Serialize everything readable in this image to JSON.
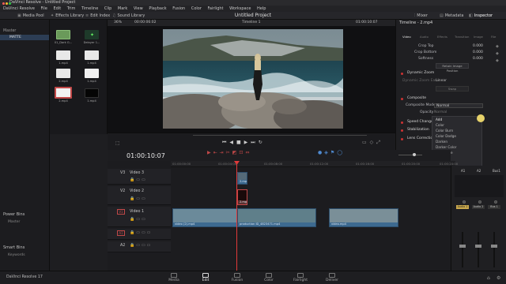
{
  "window": {
    "title": "DaVinci Resolve - Untitled Project"
  },
  "menu": [
    "DaVinci Resolve",
    "File",
    "Edit",
    "Trim",
    "Timeline",
    "Clip",
    "Mark",
    "View",
    "Playback",
    "Fusion",
    "Color",
    "Fairlight",
    "Workspace",
    "Help"
  ],
  "toolbar": {
    "media_pool": "Media Pool",
    "effects_library": "Effects Library",
    "edit_index": "Edit Index",
    "sound_library": "Sound Library",
    "project_title": "Untitled Project",
    "mixer": "Mixer",
    "metadata": "Metadata",
    "inspector": "Inspector"
  },
  "bins": {
    "master": "Master",
    "matte": "MATTE",
    "power_bins": "Power Bins",
    "power_master": "Master",
    "smart_bins": "Smart Bins",
    "keywords": "Keywords"
  },
  "media_pool": {
    "items": [
      {
        "name": "01_Dark G...",
        "color": "#6a9a5a"
      },
      {
        "name": "Delayer 1...",
        "color": "#2d5a3a"
      },
      {
        "name": "1.mp4",
        "color": "#e8e8e8"
      },
      {
        "name": "1.mp4",
        "color": "#e8e8e8"
      },
      {
        "name": "2.mp4",
        "color": "#e8e8e8"
      },
      {
        "name": "1.mp4",
        "color": "#f0f0f0"
      },
      {
        "name": "2.mp4",
        "color": "#c08080"
      },
      {
        "name": "1.mp4",
        "color": "#050505"
      }
    ]
  },
  "viewer": {
    "zoom": "36%",
    "src_tc": "00:00:06:02",
    "timeline_name": "Timeline 1",
    "rec_tc": "01:00:10:07"
  },
  "inspector": {
    "clip_name": "Timeline - 2.mp4",
    "tabs": [
      "Video",
      "Audio",
      "Effects",
      "Transition",
      "Image",
      "File"
    ],
    "crop_top_label": "Crop Top",
    "crop_top_value": "0.000",
    "crop_bottom_label": "Crop Bottom",
    "crop_bottom_value": "0.000",
    "softness_label": "Softness",
    "softness_value": "0.000",
    "retain_label": "Retain Image Position",
    "dynamic_zoom_label": "Dynamic Zoom",
    "dz_ease_label": "Dynamic Zoom Ease",
    "dz_ease_value": "Linear",
    "swap_label": "Swap",
    "composite_label": "Composite",
    "composite_mode_label": "Composite Mode",
    "composite_mode_value": "Normal",
    "opacity_label": "Opacity",
    "opacity_value": "Normal",
    "speed_change_label": "Speed Change",
    "stabilization_label": "Stabilization",
    "lens_correction_label": "Lens Correction",
    "dropdown_options": [
      "Add",
      "Color",
      "Color Burn",
      "Color Dodge",
      "Darken",
      "Darker Color",
      "Difference",
      "Divide"
    ]
  },
  "timeline": {
    "timecode": "01:00:10:07",
    "ruler_marks": [
      "01:00:00:00",
      "01:00:04:00",
      "01:00:08:00",
      "01:00:12:00",
      "01:00:16:00",
      "01:00:20:00",
      "01:00:24:00"
    ],
    "tracks": [
      {
        "id": "V3",
        "name": "Video 3"
      },
      {
        "id": "V2",
        "name": "Video 2"
      },
      {
        "id": "V1",
        "name": "Video 1"
      },
      {
        "id": "A1",
        "name": ""
      },
      {
        "id": "A2",
        "name": ""
      }
    ],
    "clips": [
      {
        "label": "2.mp4"
      },
      {
        "label": "2.mp4"
      },
      {
        "label": "video (2).mp4"
      },
      {
        "label": "production ID_4823471.mp4"
      },
      {
        "label": "video.mp4"
      }
    ]
  },
  "mixer": {
    "channels": [
      "A1",
      "A2",
      "Bus1"
    ],
    "audio_labels": [
      "Audio 1",
      "Audio 2",
      "Bus 1"
    ]
  },
  "pages": [
    "Media",
    "Edit",
    "Fusion",
    "Color",
    "Fairlight",
    "Deliver"
  ],
  "version": "DaVinci Resolve 17",
  "colors": {
    "accent_red": "#e03a3a",
    "clip_blue": "#3d6a90",
    "active_page": "#e8e8e8"
  }
}
